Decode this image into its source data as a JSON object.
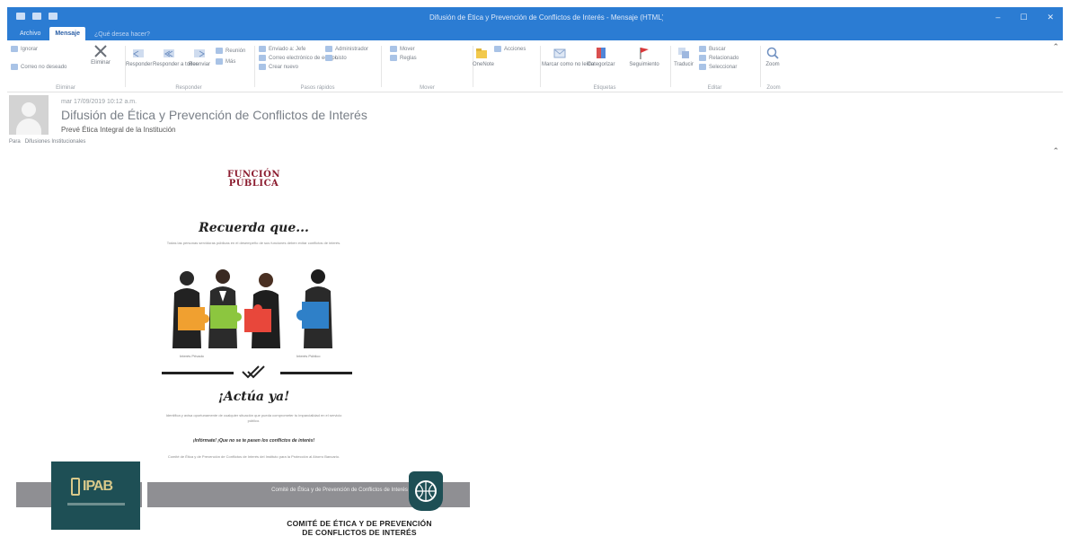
{
  "window": {
    "title": "Difusión de Ética y Prevención de Conflictos de Interés - Mensaje (HTML)",
    "controls": [
      "–",
      "☐",
      "✕"
    ]
  },
  "ribbon_tabs": [
    {
      "label": "Archivo",
      "active": false
    },
    {
      "label": "Mensaje",
      "active": true
    }
  ],
  "tell_me": "¿Qué desea hacer?",
  "ribbon": {
    "groups": [
      {
        "label": "Eliminar",
        "buttons": [
          "Ignorar",
          "Correo no deseado",
          "Eliminar"
        ]
      },
      {
        "label": "Responder",
        "buttons": [
          "Responder",
          "Responder a todos",
          "Reenviar",
          "Reunión",
          "Más"
        ]
      },
      {
        "label": "Pasos rápidos",
        "buttons": [
          "Enviado a: Jefe",
          "Correo electrónico de equipo",
          "Crear nuevo",
          "Administrador",
          "Listo"
        ]
      },
      {
        "label": "Mover",
        "buttons": [
          "Mover",
          "Reglas",
          "OneNote",
          "Acciones"
        ]
      },
      {
        "label": "Etiquetas",
        "buttons": [
          "Marcar como no leído",
          "Categorizar",
          "Seguimiento"
        ]
      },
      {
        "label": "Editar",
        "buttons": [
          "Traducir",
          "Buscar",
          "Relacionado",
          "Seleccionar"
        ]
      },
      {
        "label": "Zoom",
        "buttons": [
          "Zoom"
        ]
      }
    ]
  },
  "message": {
    "date": "mar 17/09/2019 10:12 a.m.",
    "subject": "Difusión de Ética y Prevención de Conflictos de Interés",
    "sender": "Prevé Ética Integral de la Institución",
    "to_label": "Para",
    "to_value": "Difusiones Institucionales"
  },
  "poster": {
    "logo_line1": "FUNCIÓN",
    "logo_line2": "PÚBLICA",
    "recuerda": "Recuerda que...",
    "recuerda_text": "Todas las personas servidoras públicas en el desempeño de sus funciones deben evitar conflictos de interés.",
    "caption_left": "Interés Privado",
    "caption_right": "Interés Público",
    "actua": "¡Actúa ya!",
    "actua_text": "Identifica y avisa oportunamente de cualquier situación que pueda comprometer tu imparcialidad en el servicio público.",
    "bold_line": "¡Infórmate! ¡Que no se te pasen los conflictos de interés!",
    "footer_text": "Comité de Ética y de Prevención de Conflictos de Interés del Instituto para la Protección al Ahorro Bancario."
  },
  "banner": {
    "logo": "IPAB",
    "text": "Comité de Ética y de Prevención de Conflictos de Interés",
    "comite_line1": "COMITÉ DE ÉTICA Y DE PREVENCIÓN",
    "comite_line2": "DE CONFLICTOS DE INTERÉS"
  },
  "colors": {
    "titlebar": "#2b7cd3",
    "funcion_publica": "#8c1d30",
    "ipab_teal": "#1e4f55",
    "banner_gray": "#8f8f93",
    "puzzle": [
      "#f0a030",
      "#8cc63f",
      "#e8473b",
      "#2f80c8"
    ]
  }
}
